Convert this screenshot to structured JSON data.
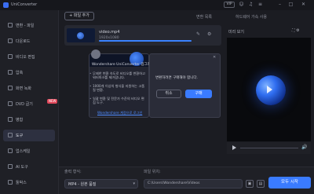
{
  "app": {
    "title": "UniConverter"
  },
  "titlebar": {
    "vip_label": "VIP"
  },
  "sidebar": {
    "items": [
      {
        "label": "변환 - 파일",
        "active": false
      },
      {
        "label": "다운로드",
        "active": false
      },
      {
        "label": "비디오 편집",
        "active": false
      },
      {
        "label": "압축",
        "active": false
      },
      {
        "label": "화면 녹화",
        "active": false
      },
      {
        "label": "DVD 굽기",
        "active": false,
        "badge": "NEW"
      },
      {
        "label": "병합",
        "active": false
      },
      {
        "label": "도구",
        "active": true
      },
      {
        "label": "업스케일",
        "active": false
      },
      {
        "label": "AI 도구",
        "active": false
      },
      {
        "label": "툴박스",
        "active": false
      }
    ]
  },
  "toolbar": {
    "add_file_label": "+ 파일 추가",
    "header_label_1": "변환 목록",
    "header_label_2": "하드웨어 가속 사용"
  },
  "file": {
    "name": "video.mp4",
    "sub": "1920x1080",
    "progress": 1.0,
    "edit_icon": "✎",
    "settings_icon": "⚙"
  },
  "preview": {
    "title": "미리 보기",
    "controls": "⛶ ⚙",
    "volume_icon": "🔊"
  },
  "popup_left": {
    "heading": "Wondershare UniConverter 업그레이드",
    "bullets": [
      "무제한 변환 속도로 비디오를 변환하고 워터마크를 제거합니다.",
      "1000개 이상의 형식을 지원하는 고품질 변환.",
      "일괄 변환 및 전문가 수준의 비디오 편집 도구."
    ],
    "link": "Wondershare 계정으로 로그인"
  },
  "popup_right": {
    "close_icon": "✕",
    "message": "변환하려면 구매해야 합니다.",
    "cancel_label": "취소",
    "buy_label": "구매"
  },
  "bottom": {
    "format_label": "출력 형식:",
    "format_value": "MP4 - 원본 품질",
    "location_label": "파일 위치:",
    "path": "C:\\Users\\Wondershare\\Videos",
    "folder_icon": "▣",
    "merge_icon": "▤",
    "start_label": "모두 시작"
  },
  "colors": {
    "accent": "#3a7bff",
    "background": "#1b1c22",
    "sidebar": "#1f2026"
  }
}
